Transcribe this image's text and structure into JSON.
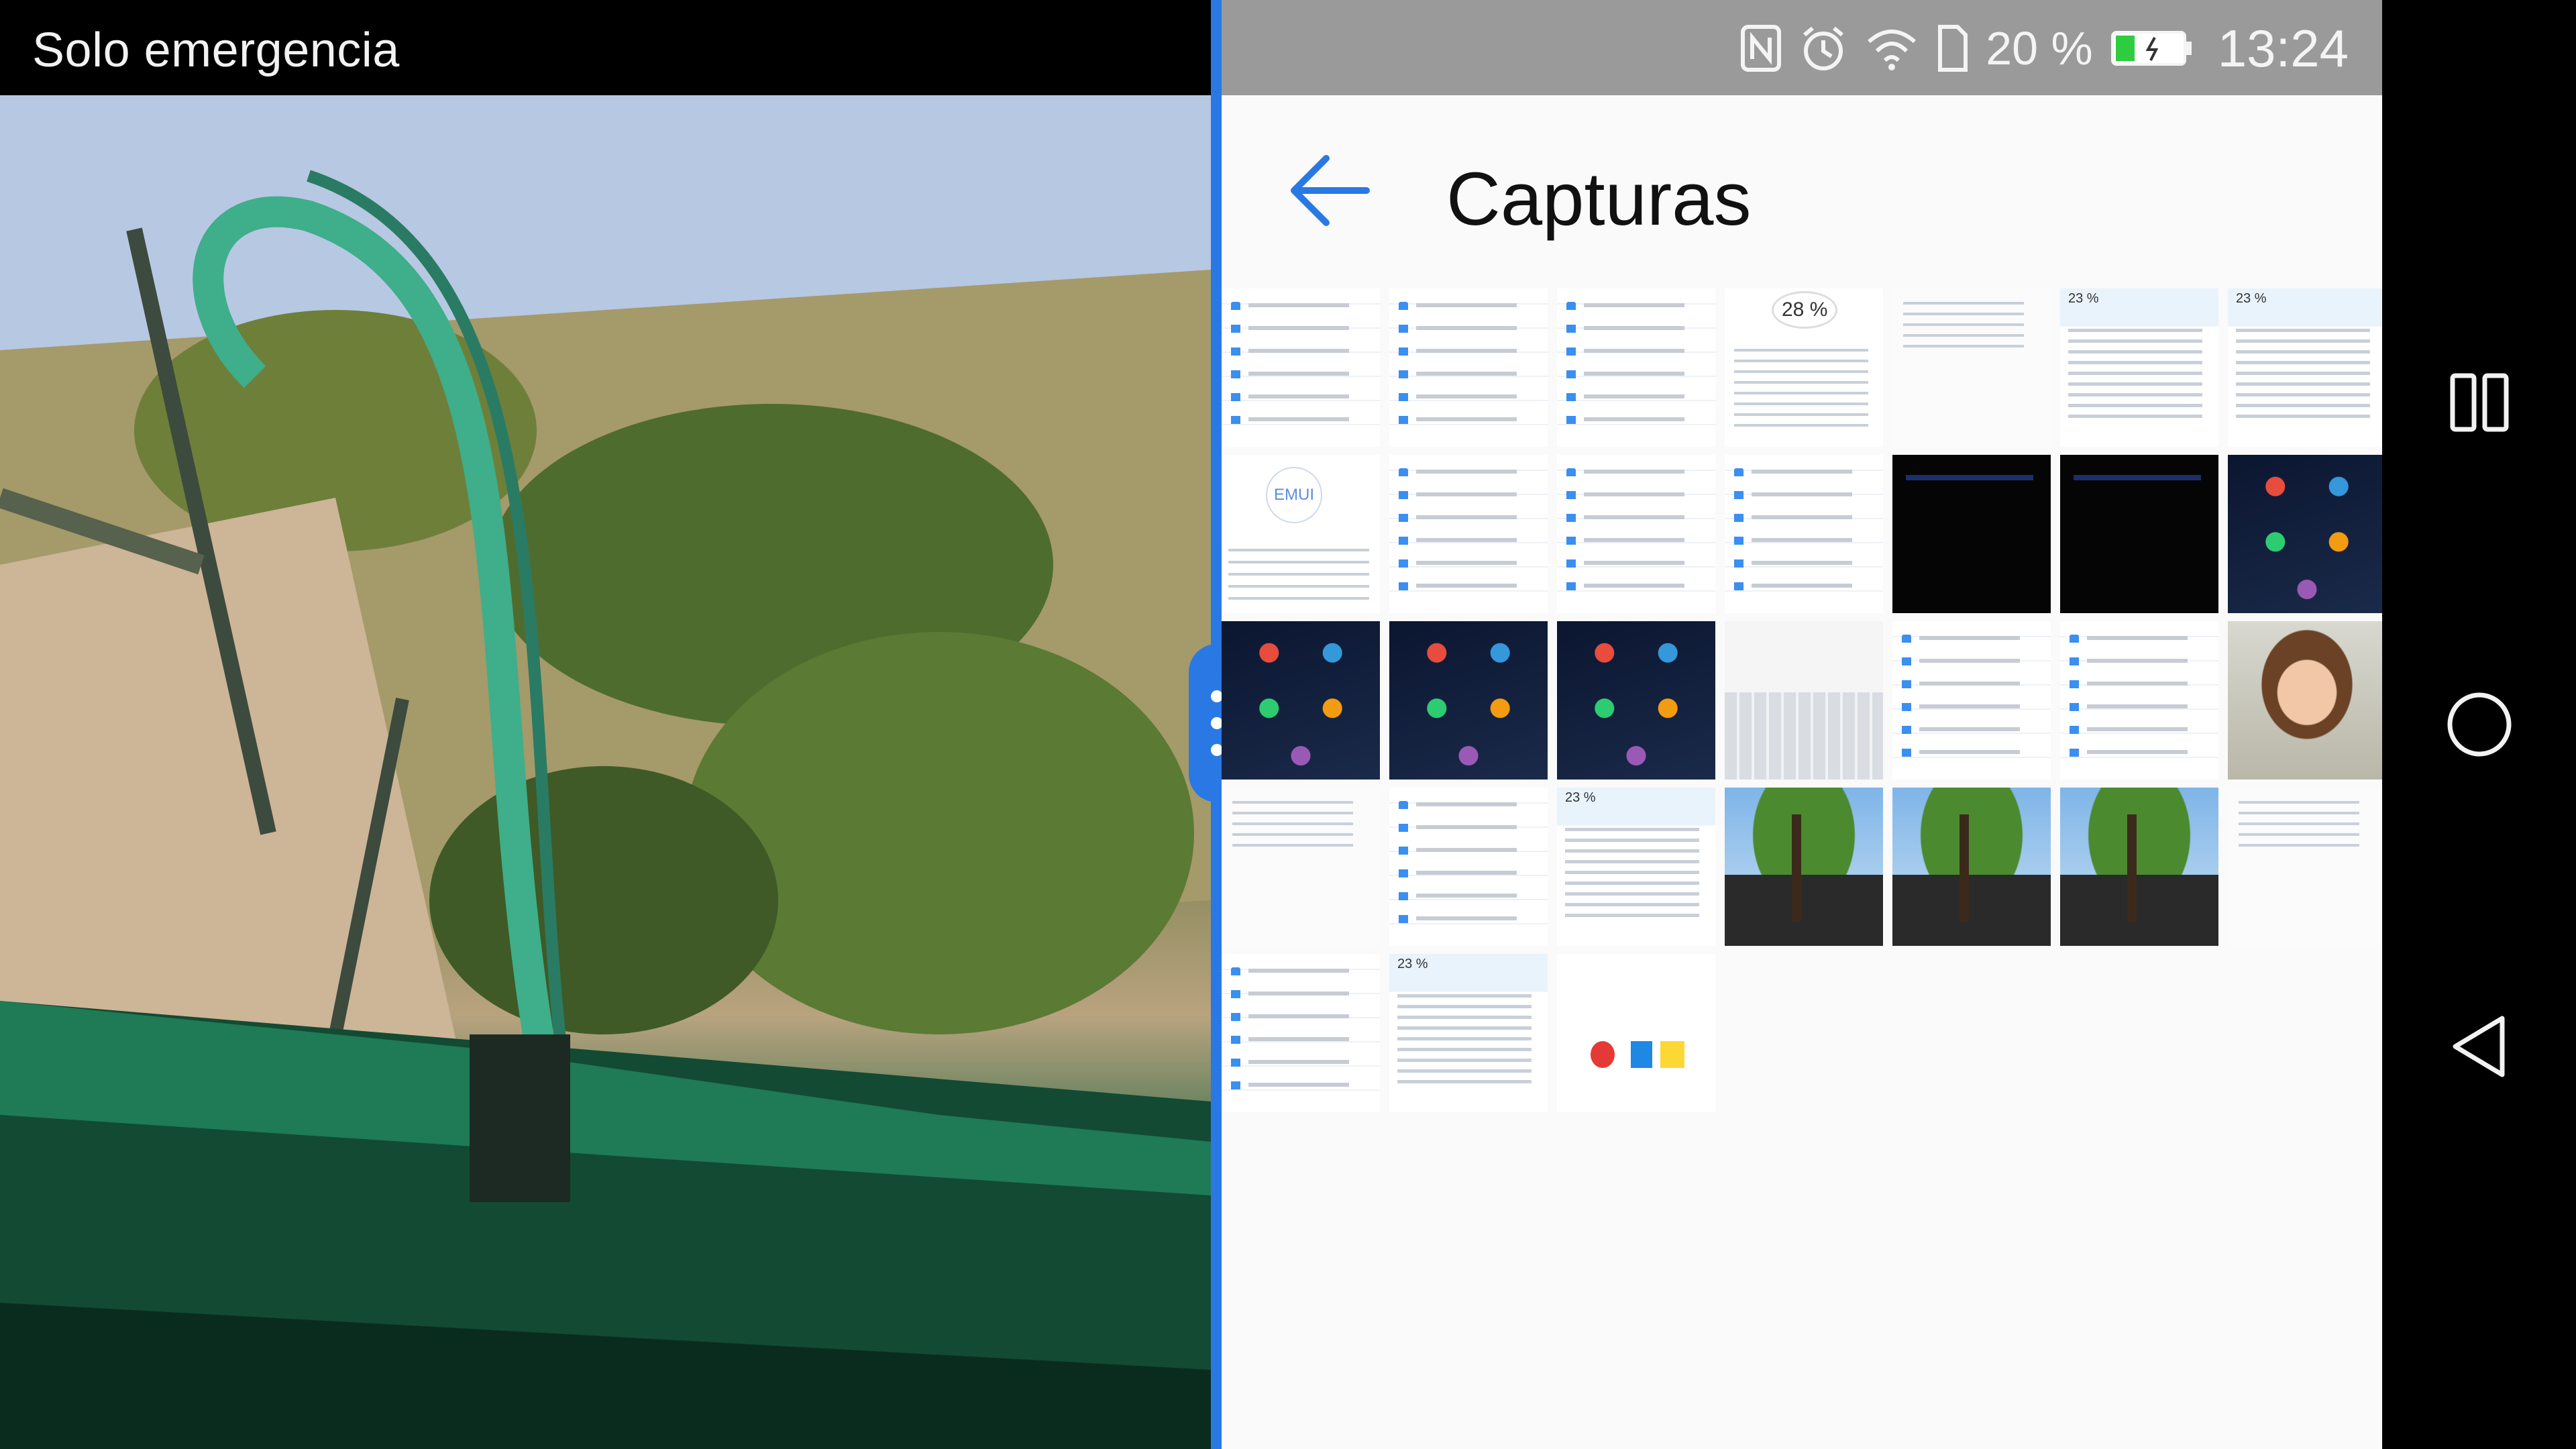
{
  "left_pane": {
    "status_bar": {
      "carrier_text": "Solo emergencia"
    },
    "video": {
      "subject": "roller-coaster-pov-video"
    }
  },
  "divider": {
    "color": "#2a78e4"
  },
  "right_pane": {
    "status_bar": {
      "icons": [
        "nfc-icon",
        "alarm-icon",
        "wifi-icon",
        "sim-icon",
        "battery-icon"
      ],
      "battery_percent": "20 %",
      "time": "13:24"
    },
    "app_bar": {
      "back_icon": "back-arrow-icon",
      "title": "Capturas"
    },
    "gallery": {
      "rows": [
        [
          "settings",
          "settings",
          "settings",
          "battery",
          "blank",
          "quota",
          "quota"
        ],
        [
          "emui",
          "settings",
          "settings",
          "settings",
          "dark",
          "dark",
          "homescreen"
        ],
        [
          "homescreen",
          "homescreen",
          "homescreen",
          "keyboard",
          "settings",
          "settings",
          "portrait"
        ],
        [
          "blank",
          "settings",
          "quota",
          "photo-tree",
          "photo-tree",
          "photo-tree",
          "blank"
        ],
        [
          "settings",
          "quota",
          "apps"
        ]
      ]
    }
  },
  "nav_bar": {
    "buttons": [
      "recents-icon",
      "home-icon",
      "back-triangle-icon"
    ]
  },
  "colors": {
    "accent": "#2a78e4",
    "status_bar_right": "#9a9a9a",
    "background": "#fafafa"
  }
}
